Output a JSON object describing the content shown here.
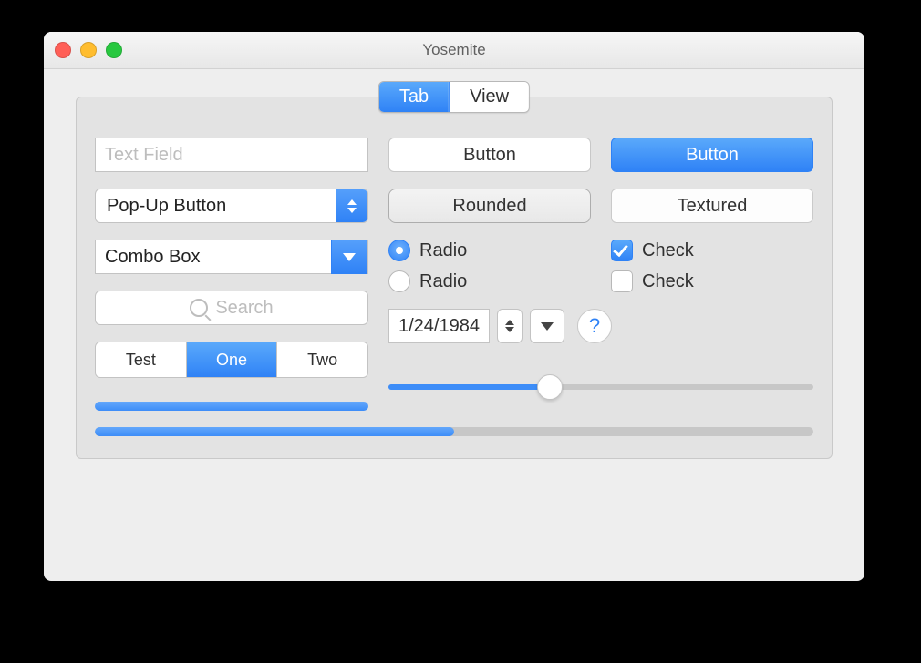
{
  "window": {
    "title": "Yosemite"
  },
  "tabs": {
    "items": [
      {
        "label": "Tab",
        "active": true
      },
      {
        "label": "View",
        "active": false
      }
    ]
  },
  "left": {
    "text_field_placeholder": "Text Field",
    "popup_label": "Pop-Up Button",
    "combo_label": "Combo Box",
    "search_placeholder": "Search",
    "segmented": {
      "items": [
        {
          "label": "Test",
          "active": false
        },
        {
          "label": "One",
          "active": true
        },
        {
          "label": "Two",
          "active": false
        }
      ]
    },
    "indeterminate_progress": {
      "indeterminate": true
    }
  },
  "mid": {
    "button_plain_label": "Button",
    "button_rounded_label": "Rounded",
    "radios": [
      {
        "label": "Radio",
        "checked": true
      },
      {
        "label": "Radio",
        "checked": false
      }
    ]
  },
  "right": {
    "button_default_label": "Button",
    "button_textured_label": "Textured",
    "checks": [
      {
        "label": "Check",
        "checked": true
      },
      {
        "label": "Check",
        "checked": false
      }
    ]
  },
  "date_row": {
    "date_value": "1/24/1984",
    "help_label": "?"
  },
  "slider": {
    "value": 0.38
  },
  "progress_bottom": {
    "value": 0.5
  },
  "colors": {
    "accent": "#2f82f6",
    "track": "#c7c7c7"
  }
}
